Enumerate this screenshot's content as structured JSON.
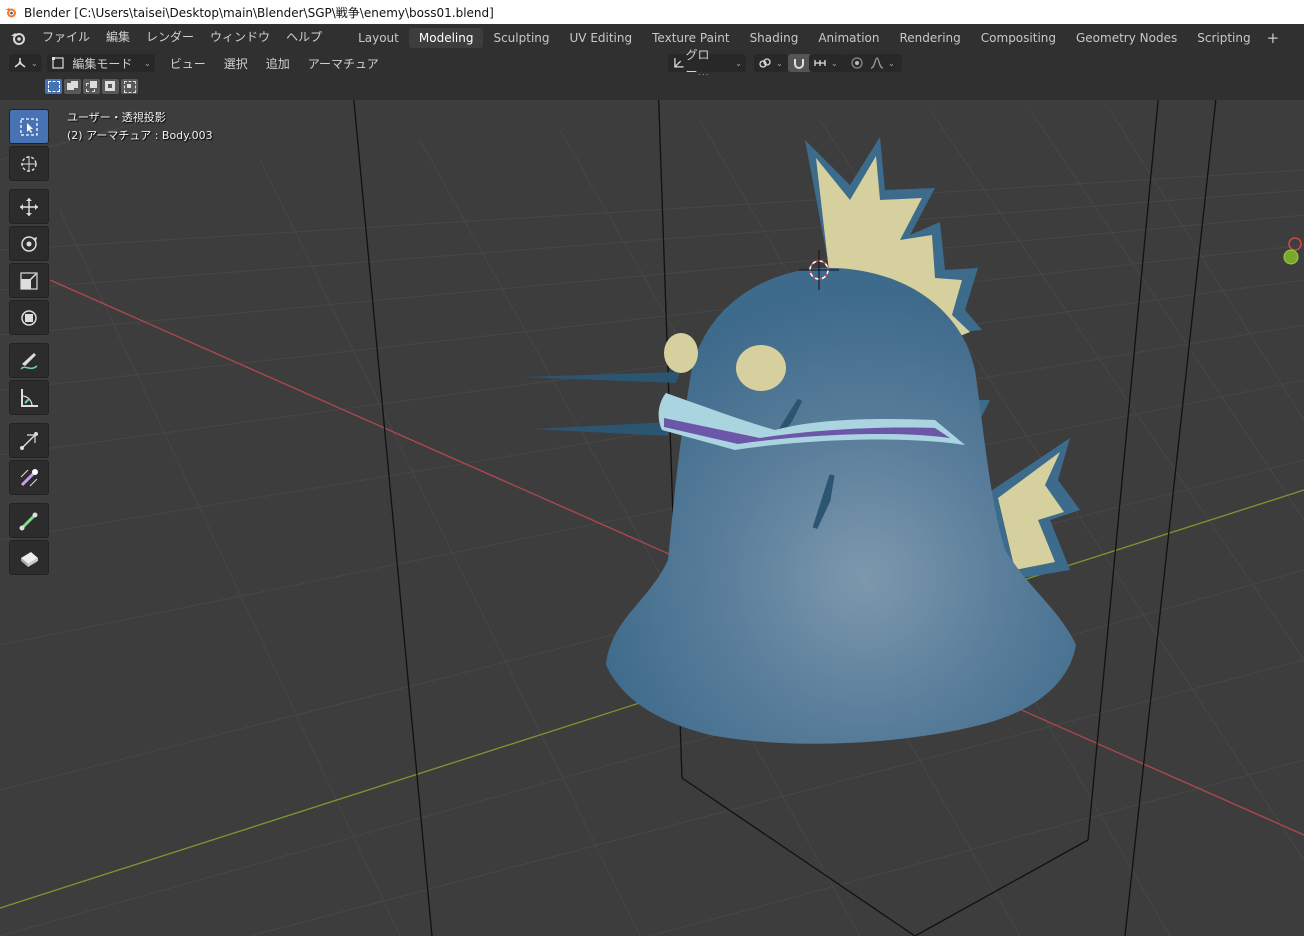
{
  "window": {
    "title": "Blender [C:\\Users\\taisei\\Desktop\\main\\Blender\\SGP\\戦争\\enemy\\boss01.blend]"
  },
  "menu": {
    "items": [
      "ファイル",
      "編集",
      "レンダー",
      "ウィンドウ",
      "ヘルプ"
    ]
  },
  "workspaces": {
    "tabs": [
      "Layout",
      "Modeling",
      "Sculpting",
      "UV Editing",
      "Texture Paint",
      "Shading",
      "Animation",
      "Rendering",
      "Compositing",
      "Geometry Nodes",
      "Scripting"
    ],
    "active": "Modeling",
    "add": "+"
  },
  "header": {
    "mode": "編集モード",
    "menus": [
      "ビュー",
      "選択",
      "追加",
      "アーマチュア"
    ],
    "transform_orientation": "グロー...",
    "snap_icon": "magnet-icon",
    "proportional_icon": "proportional-edit-icon"
  },
  "toolbar": {
    "tools": [
      "select-box-icon",
      "cursor-icon",
      "move-icon",
      "rotate-icon",
      "scale-icon",
      "transform-icon",
      "annotate-icon",
      "measure-icon",
      "extrude-icon",
      "extrude-to-cursor-icon",
      "roll-icon",
      "bone-size-icon"
    ],
    "active": "select-box-icon"
  },
  "viewport": {
    "view_label": "ユーザー・透視投影",
    "object_label": "(2) アーマチュア : Body.003",
    "colors": {
      "background": "#3d3d3d",
      "x_axis": "#b0474f",
      "y_axis": "#7a9a2e",
      "body": "#4e7595",
      "spikes": "#d6d09e",
      "outline": "#3d6b8c"
    }
  }
}
